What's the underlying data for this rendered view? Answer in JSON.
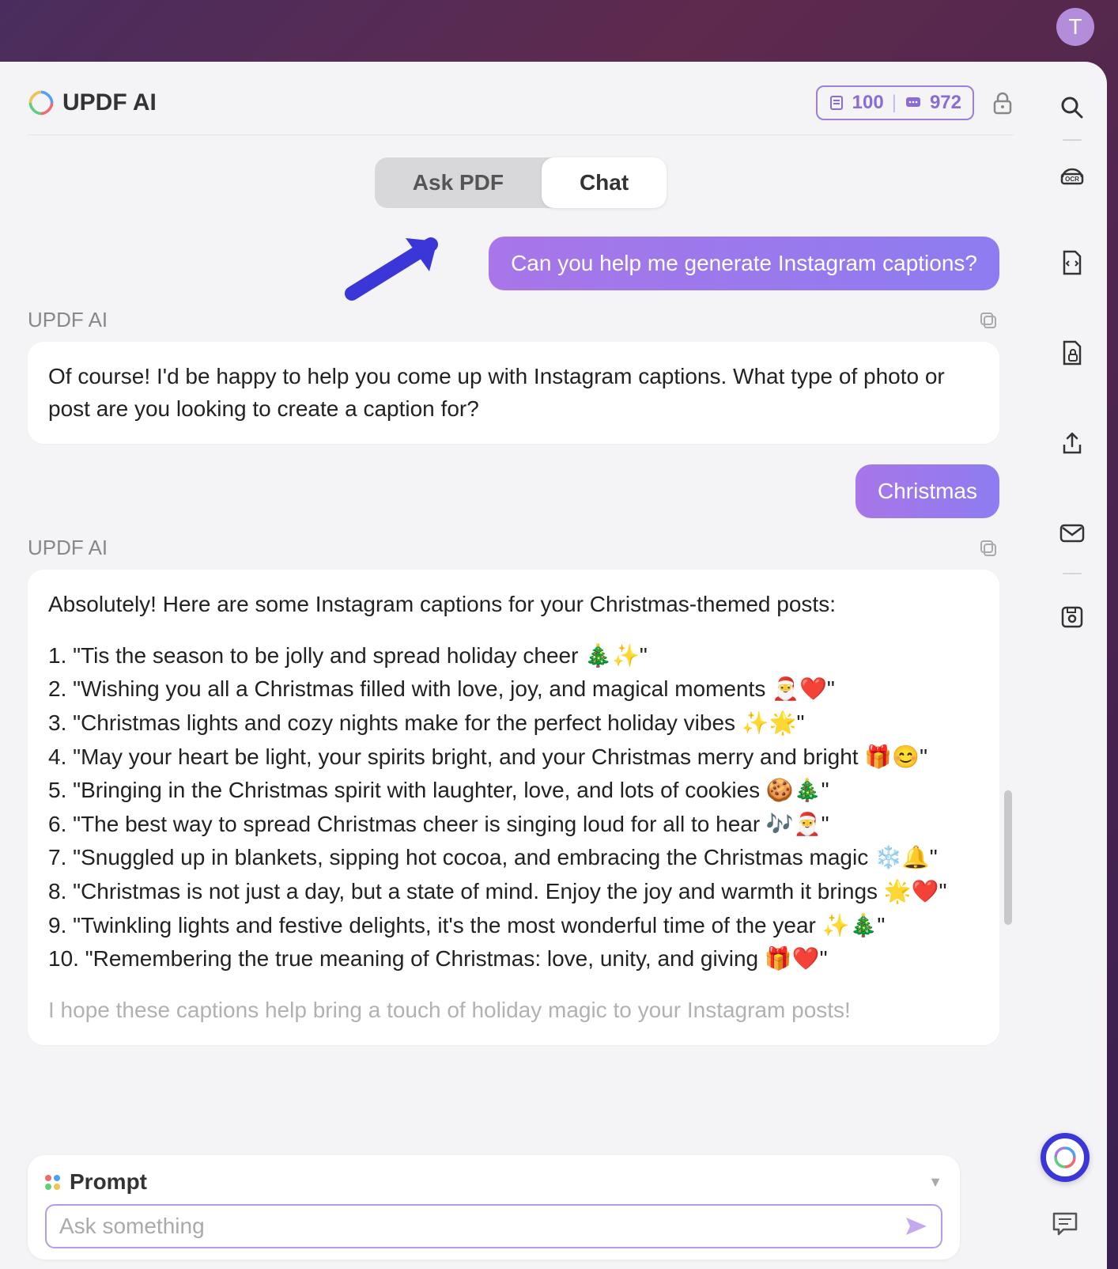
{
  "avatar_initial": "T",
  "app_title": "UPDF AI",
  "counts": {
    "pages": "100",
    "credits": "972"
  },
  "tabs": {
    "ask_pdf": "Ask PDF",
    "chat": "Chat",
    "active": "chat"
  },
  "messages": {
    "user1": "Can you help me generate Instagram captions?",
    "ai_label": "UPDF AI",
    "ai1": "Of course! I'd be happy to help you come up with Instagram captions. What type of photo or post are you looking to create a caption for?",
    "user2": "Christmas",
    "ai2_intro": "Absolutely! Here are some Instagram captions for your Christmas-themed posts:",
    "captions": [
      "1. \"Tis the season to be jolly and spread holiday cheer 🎄✨\"",
      "2. \"Wishing you all a Christmas filled with love, joy, and magical moments 🎅❤️\"",
      "3. \"Christmas lights and cozy nights make for the perfect holiday vibes ✨🌟\"",
      "4. \"May your heart be light, your spirits bright, and your Christmas merry and bright 🎁😊\"",
      "5. \"Bringing in the Christmas spirit with laughter, love, and lots of cookies 🍪🎄\"",
      "6. \"The best way to spread Christmas cheer is singing loud for all to hear 🎶🎅\"",
      "7. \"Snuggled up in blankets, sipping hot cocoa, and embracing the Christmas magic ❄️🔔\"",
      "8. \"Christmas is not just a day, but a state of mind. Enjoy the joy and warmth it brings 🌟❤️\"",
      "9. \"Twinkling lights and festive delights, it's the most wonderful time of the year ✨🎄\"",
      "10. \"Remembering the true meaning of Christmas: love, unity, and giving 🎁❤️\""
    ],
    "ai2_outro": "I hope these captions help bring a touch of holiday magic to your Instagram posts!"
  },
  "composer": {
    "prompt_label": "Prompt",
    "placeholder": "Ask something"
  }
}
